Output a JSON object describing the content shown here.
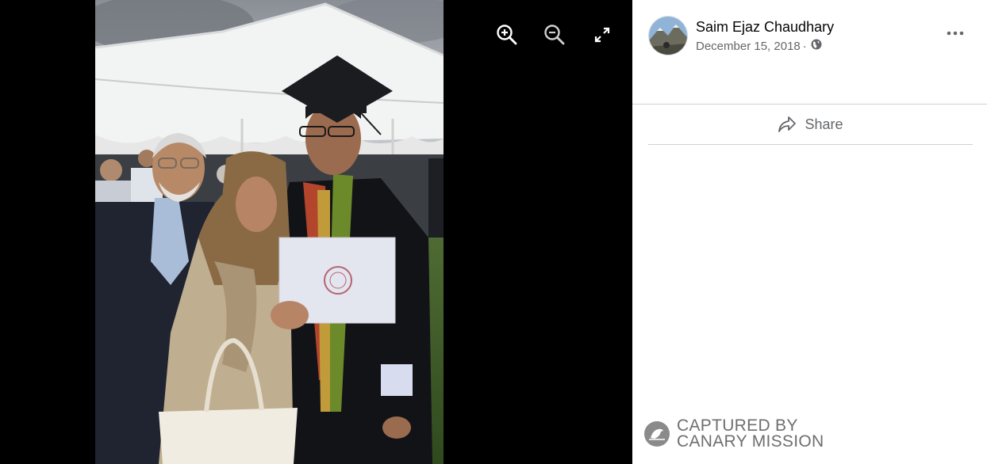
{
  "post": {
    "author": "Saim Ejaz Chaudhary",
    "date": "December 15, 2018",
    "separator": "·",
    "privacy_icon": "globe-icon"
  },
  "viewer": {
    "controls": [
      "zoom-in-icon",
      "zoom-out-icon",
      "fullscreen-icon"
    ]
  },
  "actions": {
    "share_label": "Share",
    "more_icon": "more-options-icon"
  },
  "watermark": {
    "line1": "CAPTURED BY",
    "line2": "CANARY MISSION"
  },
  "colors": {
    "text_primary": "#050505",
    "text_secondary": "#65676b",
    "divider": "#ced0d4",
    "viewer_bg": "#000000"
  }
}
